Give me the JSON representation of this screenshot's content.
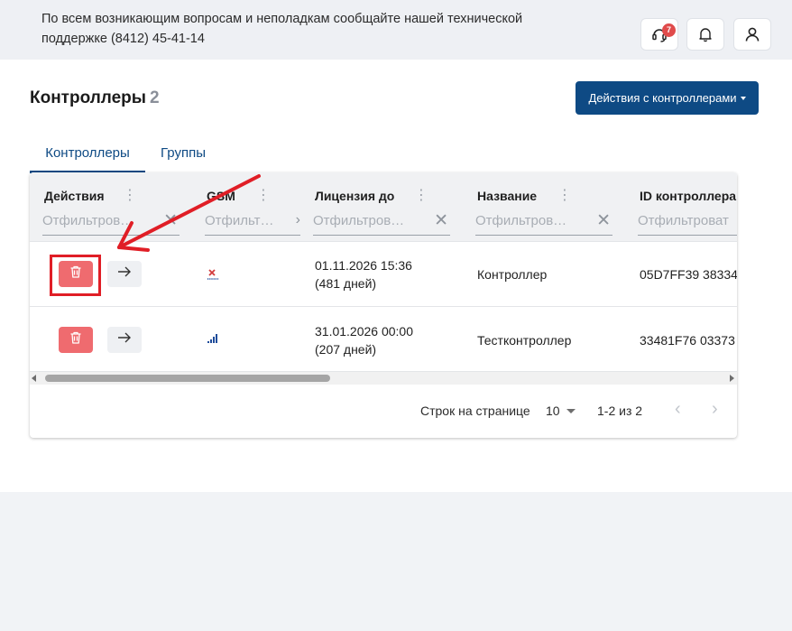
{
  "header": {
    "support_text": "По всем возникающим вопросам и неполадкам сообщайте нашей технической поддержке (8412) 45-41-14",
    "support_badge": "7",
    "icons": [
      "headset-icon",
      "bell-icon",
      "user-icon"
    ]
  },
  "page": {
    "title": "Контроллеры",
    "count": "2",
    "actions_button": "Действия с контроллерами"
  },
  "tabs": [
    {
      "label": "Контроллеры",
      "active": true
    },
    {
      "label": "Группы",
      "active": false
    }
  ],
  "table": {
    "columns": [
      {
        "label": "Действия",
        "filter_placeholder": "Отфильтров…"
      },
      {
        "label": "GSM",
        "filter_placeholder": "Отфильт…"
      },
      {
        "label": "Лицензия до",
        "filter_placeholder": "Отфильтров…"
      },
      {
        "label": "Название",
        "filter_placeholder": "Отфильтров…"
      },
      {
        "label": "ID контроллера",
        "filter_placeholder": "Отфильтроват"
      }
    ],
    "rows": [
      {
        "gsm_status": "no-signal",
        "license_date": "01.11.2026 15:36",
        "license_days": "(481 дней)",
        "name": "Контроллер",
        "controller_id": "05D7FF39 38334"
      },
      {
        "gsm_status": "signal",
        "license_date": "31.01.2026 00:00",
        "license_days": "(207 дней)",
        "name": "Тестконтроллер",
        "controller_id": "33481F76 03373"
      }
    ]
  },
  "pagination": {
    "rows_per_page_label": "Строк на странице",
    "rows_per_page": "10",
    "range": "1-2 из 2"
  },
  "colors": {
    "primary": "#0e4a84",
    "delete": "#ef6b6f",
    "annotation": "#e01e26"
  }
}
